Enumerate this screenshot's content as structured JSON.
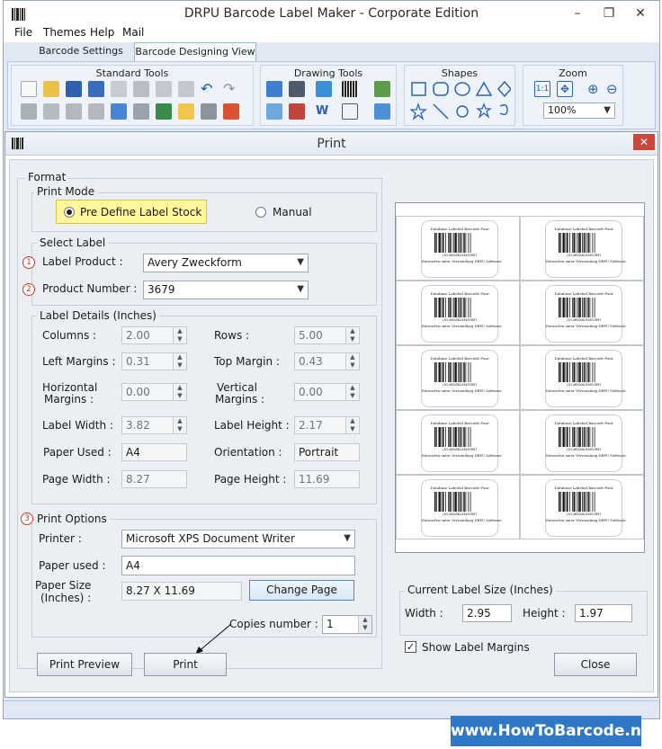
{
  "app": {
    "title": "DRPU Barcode Label Maker - Corporate Edition"
  },
  "menu": [
    "File",
    "Themes",
    "Help",
    "Mail"
  ],
  "tabs": [
    "Barcode Settings",
    "Barcode Designing View"
  ],
  "ribbon": {
    "groups": [
      "Standard Tools",
      "Drawing Tools",
      "Shapes",
      "Zoom"
    ],
    "zoom_value": "100%"
  },
  "dialog": {
    "title": "Print",
    "format_label": "Format",
    "print_mode": {
      "label": "Print Mode",
      "option_predefine": "Pre Define Label Stock",
      "option_manual": "Manual",
      "selected": "predefine"
    },
    "select_label": {
      "label": "Select Label",
      "badge_1": "1",
      "badge_2": "2",
      "label_product_label": "Label Product :",
      "label_product_value": "Avery Zweckform",
      "product_number_label": "Product Number :",
      "product_number_value": "3679"
    },
    "label_details": {
      "label": "Label Details (Inches)",
      "columns_label": "Columns :",
      "columns": "2.00",
      "rows_label": "Rows :",
      "rows": "5.00",
      "left_margins_label": "Left Margins :",
      "left_margins": "0.31",
      "top_margin_label": "Top Margin :",
      "top_margin": "0.43",
      "horizontal_margins_label_1": "Horizontal",
      "horizontal_margins_label_2": "Margins :",
      "horizontal_margins": "0.00",
      "vertical_margins_label_1": "Vertical",
      "vertical_margins_label_2": "Margins :",
      "vertical_margins": "0.00",
      "label_width_label": "Label Width :",
      "label_width": "3.82",
      "label_height_label": "Label Height :",
      "label_height": "2.17",
      "paper_used_label": "Paper Used :",
      "paper_used": "A4",
      "orientation_label": "Orientation :",
      "orientation": "Portrait",
      "page_width_label": "Page Width :",
      "page_width": "8.27",
      "page_height_label": "Page Height :",
      "page_height": "11.69"
    },
    "print_options": {
      "label": "Print Options",
      "badge_3": "3",
      "printer_label": "Printer :",
      "printer_value": "Microsoft XPS Document Writer",
      "paper_used_label": "Paper used :",
      "paper_used_value": "A4",
      "paper_size_label_1": "Paper Size",
      "paper_size_label_2": "(Inches) :",
      "paper_size_value": "8.27 X 11.69",
      "change_page_button": "Change Page",
      "copies_label": "Copies number :",
      "copies_value": "1"
    },
    "preview_label": {
      "title": "Database Labeled Barcode Font",
      "code": "(01)00350245637897",
      "footer": "Entworfen unter Verwendung DRPU Software"
    },
    "current_label_size": {
      "label": "Current Label Size (Inches)",
      "width_label": "Width :",
      "width": "2.95",
      "height_label": "Height :",
      "height": "1.97"
    },
    "show_label_margins": {
      "label": "Show Label Margins",
      "checked": true
    },
    "buttons": {
      "print_preview": "Print Preview",
      "print": "Print",
      "close": "Close"
    }
  },
  "watermark": "www.HowToBarcode.net"
}
